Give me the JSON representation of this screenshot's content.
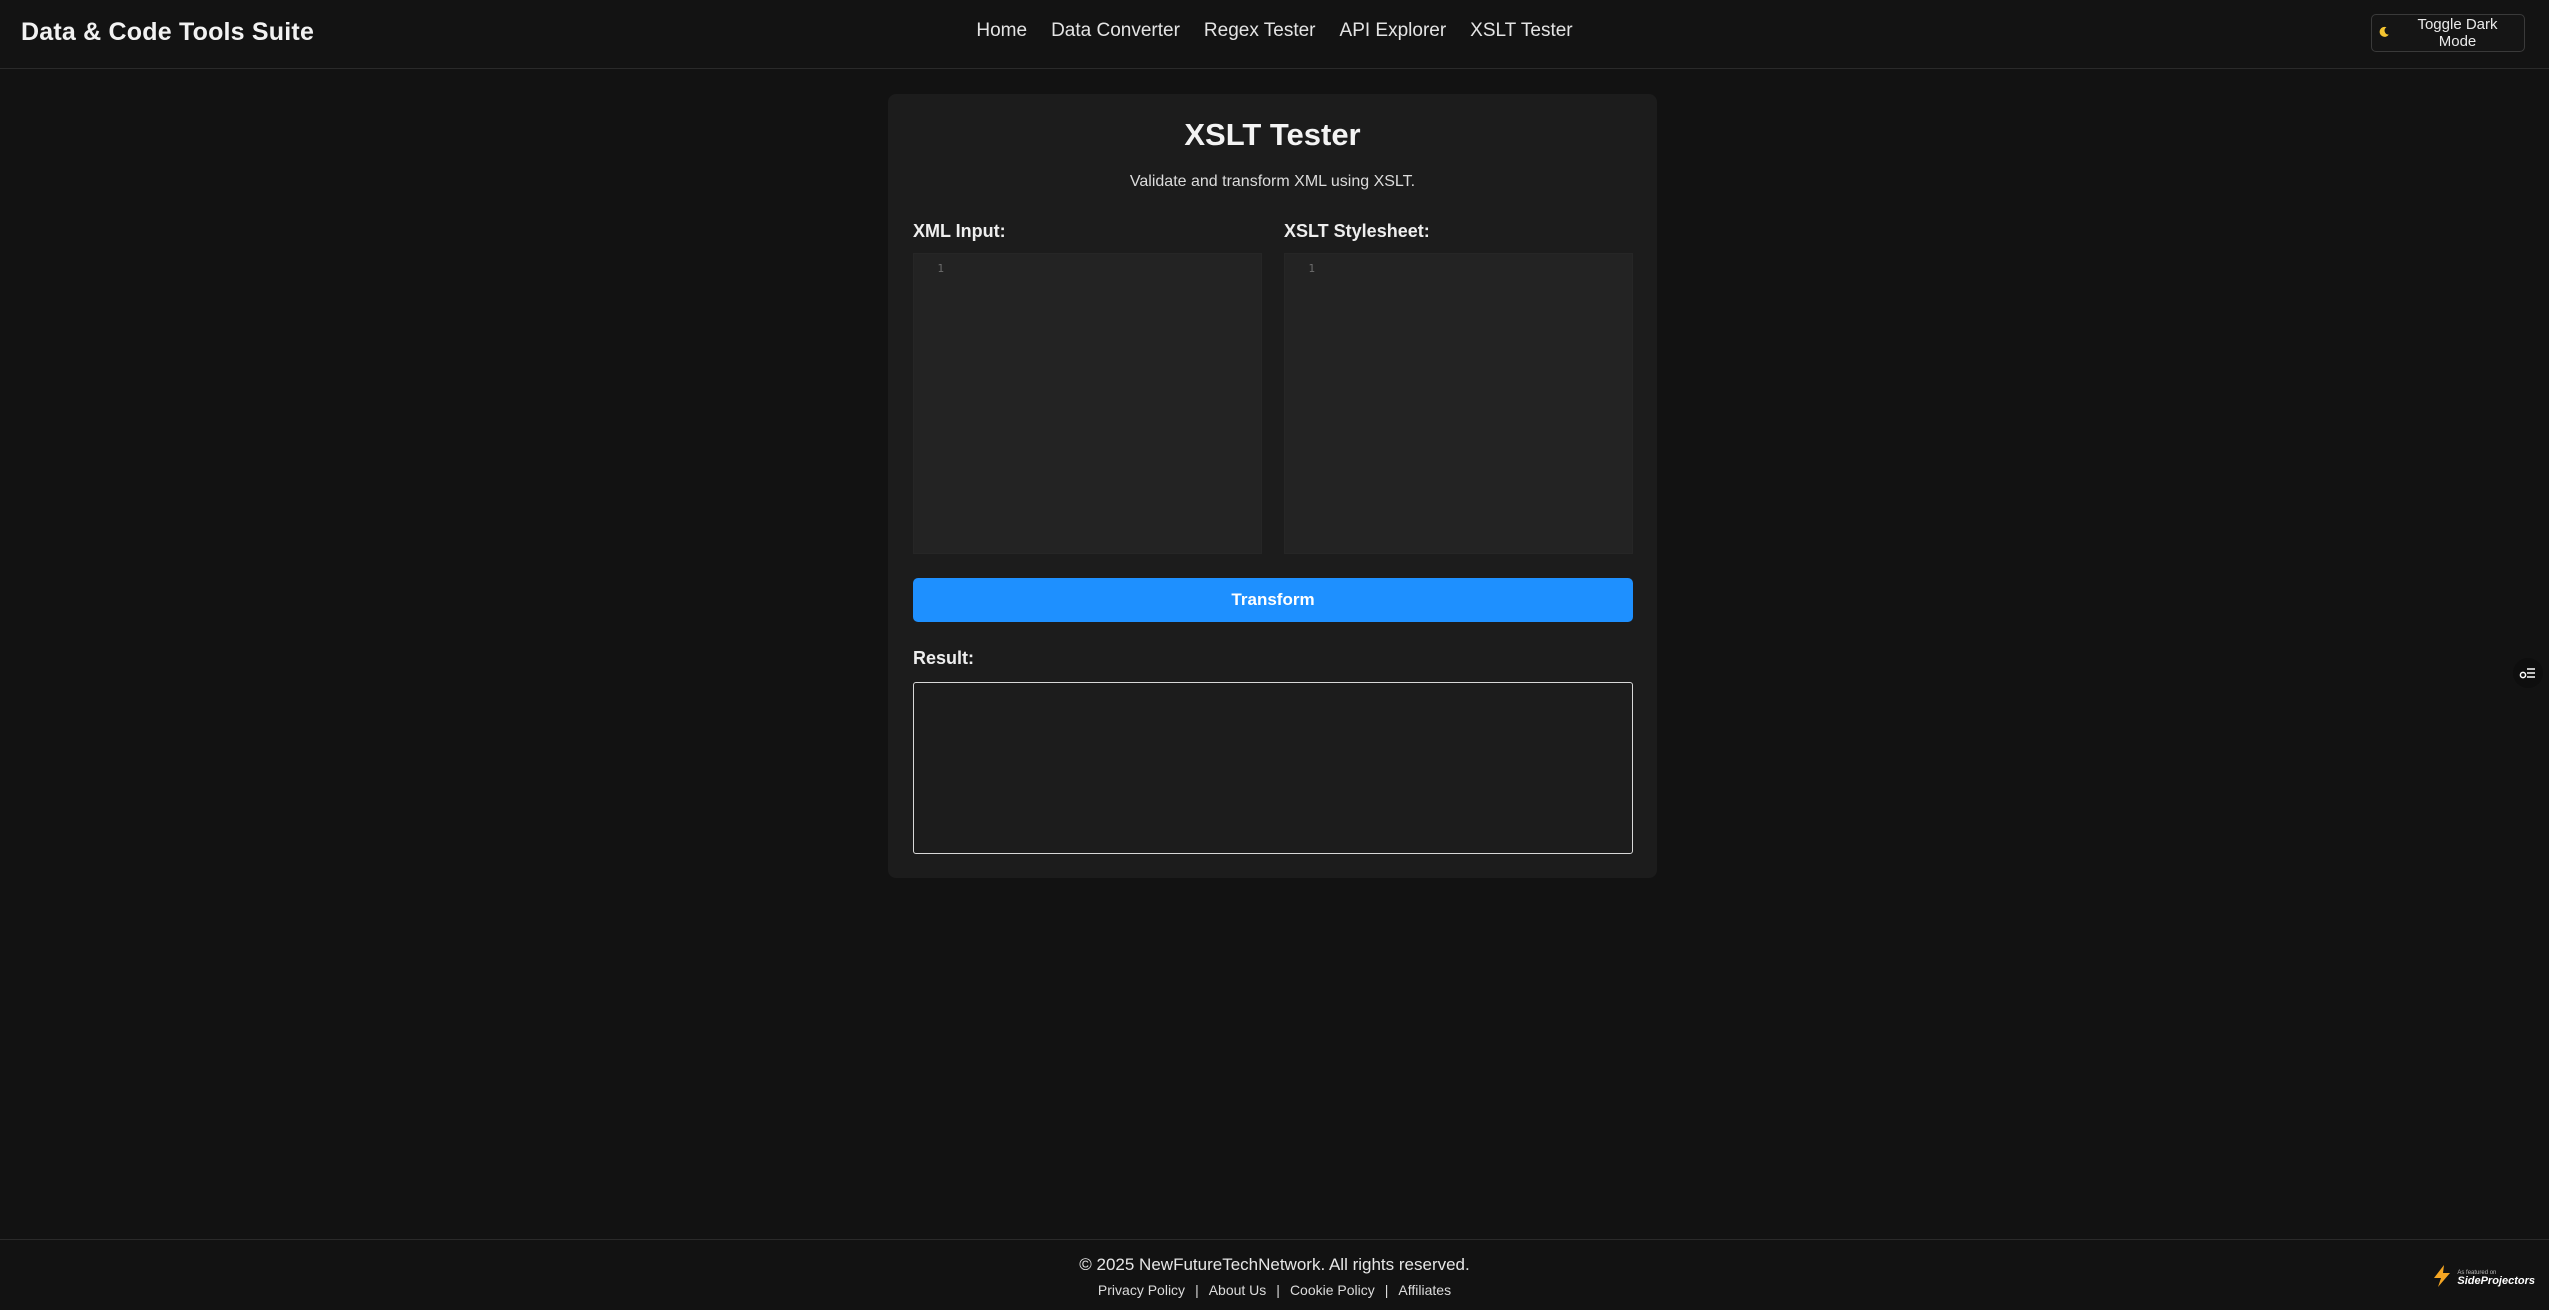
{
  "header": {
    "brand": "Data & Code Tools Suite",
    "nav": [
      "Home",
      "Data Converter",
      "Regex Tester",
      "API Explorer",
      "XSLT Tester"
    ],
    "toggle_label": "Toggle Dark Mode"
  },
  "main": {
    "title": "XSLT Tester",
    "subtitle": "Validate and transform XML using XSLT.",
    "xml_label": "XML Input:",
    "xml_line_number": "1",
    "xml_value": "",
    "xslt_label": "XSLT Stylesheet:",
    "xslt_line_number": "1",
    "xslt_value": "",
    "transform_label": "Transform",
    "result_label": "Result:",
    "result_value": ""
  },
  "footer": {
    "copyright": "© 2025 NewFutureTechNetwork. All rights reserved.",
    "links": [
      "Privacy Policy",
      "About Us",
      "Cookie Policy",
      "Affiliates"
    ],
    "separator": "|",
    "badge_small": "As featured on",
    "badge_big": "SideProjectors"
  },
  "colors": {
    "background": "#121212",
    "card": "#1c1c1c",
    "editor": "#232323",
    "accent": "#1e90ff",
    "moon": "#f4c430"
  },
  "icons": {
    "toggle": "moon-icon",
    "widget": "list-settings-icon",
    "badge": "lightning-icon"
  }
}
